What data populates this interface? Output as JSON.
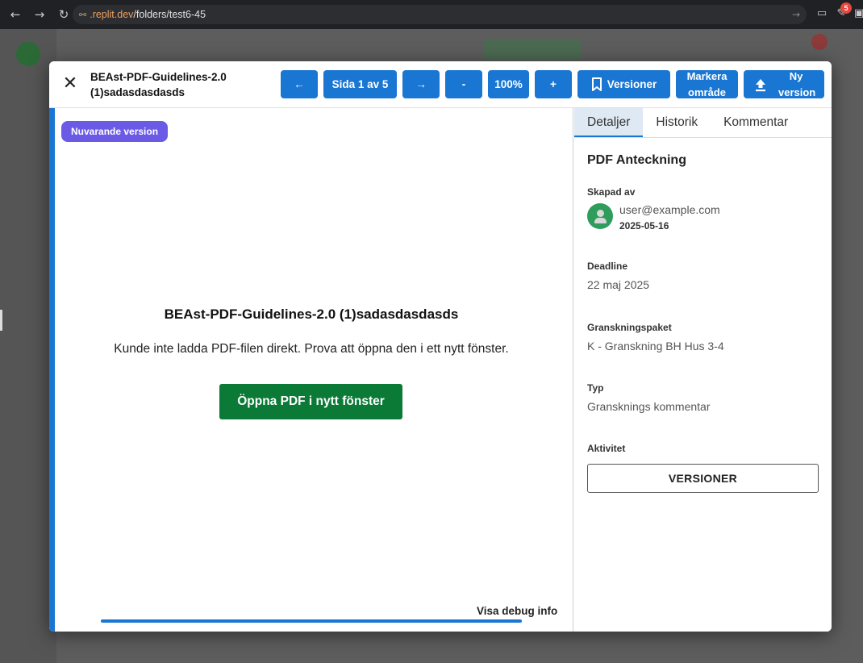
{
  "browser": {
    "url_host": ".replit.dev",
    "url_path": "/folders/test6-45",
    "extension_badge": "5"
  },
  "modal": {
    "title": "BEAst-PDF-Guidelines-2.0 (1)sadasdasdasds",
    "toolbar": {
      "prev_label": "←",
      "page_label": "Sida 1 av 5",
      "next_label": "→",
      "zoom_out_label": "-",
      "zoom_level": "100%",
      "zoom_in_label": "+",
      "versions_label": "Versioner",
      "mark_area_label": "Markera område",
      "new_version_label": "Ny version"
    }
  },
  "viewer": {
    "version_chip": "Nuvarande version",
    "title": "BEAst-PDF-Guidelines-2.0 (1)sadasdasdasds",
    "message": "Kunde inte ladda PDF-filen direkt. Prova att öppna den i ett nytt fönster.",
    "open_button": "Öppna PDF i nytt fönster",
    "debug_link": "Visa debug info",
    "progress": 1.0
  },
  "side": {
    "tabs": [
      "Detaljer",
      "Historik",
      "Kommentar"
    ],
    "active_tab": "Detaljer",
    "title": "PDF Anteckning",
    "created_by_label": "Skapad av",
    "creator_email": "user@example.com",
    "created_date": "2025-05-16",
    "deadline_label": "Deadline",
    "deadline_value": "22 maj 2025",
    "package_label": "Granskningspaket",
    "package_value": "K - Granskning BH Hus 3-4",
    "type_label": "Typ",
    "type_value": "Gransknings kommentar",
    "activity_label": "Aktivitet",
    "versions_button": "VERSIONER"
  },
  "colors": {
    "primary": "#1976d2",
    "chip": "#6b5ae6",
    "open_button": "#0b7a36",
    "avatar": "#2e9d5c"
  }
}
